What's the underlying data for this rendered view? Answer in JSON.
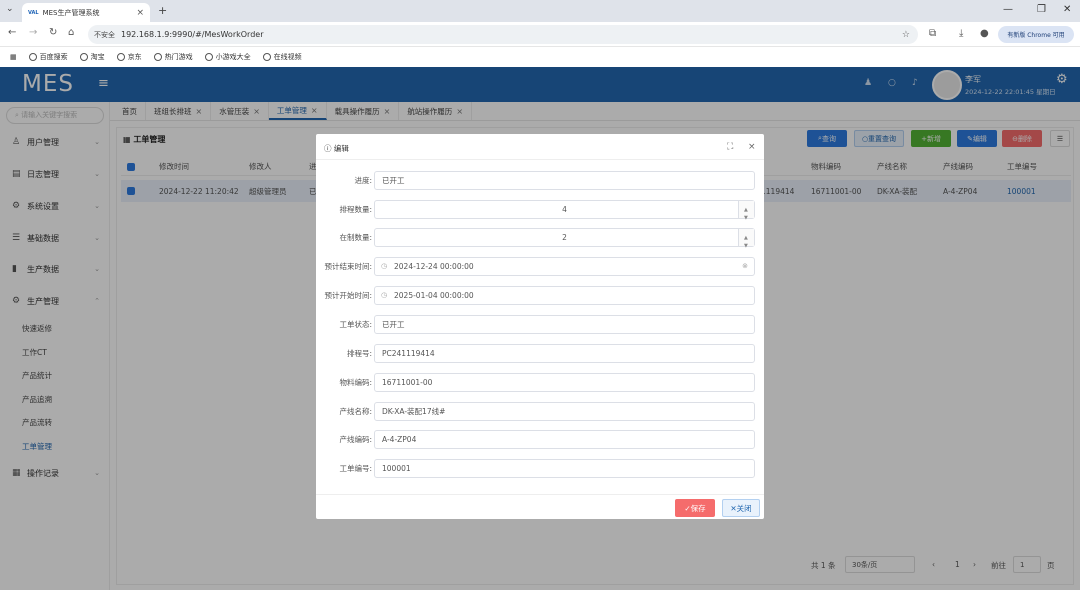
{
  "browser": {
    "tab_title": "MES生产管理系统",
    "tab_favicon": "VAL",
    "security_label": "不安全",
    "url": "192.168.1.9:9990/#/MesWorkOrder",
    "update_label": "有新版 Chrome 可用",
    "bookmarks": [
      "百度搜索",
      "淘宝",
      "京东",
      "热门游戏",
      "小游戏大全",
      "在线视频"
    ]
  },
  "header": {
    "logo": "MES",
    "user_name": "李军",
    "user_time": "2024-12-22 22:01:45 星期日"
  },
  "sidebar": {
    "search_placeholder": "请输入关键字搜索",
    "items": [
      {
        "label": "用户管理",
        "icon": "user-icon"
      },
      {
        "label": "日志管理",
        "icon": "calendar-icon"
      },
      {
        "label": "系统设置",
        "icon": "gear-icon"
      },
      {
        "label": "基础数据",
        "icon": "sliders-icon"
      },
      {
        "label": "生产数据",
        "icon": "bar-chart-icon"
      },
      {
        "label": "生产管理",
        "icon": "gear-icon"
      },
      {
        "label": "操作记录",
        "icon": "grid-icon"
      }
    ],
    "subitems": [
      "快速返修",
      "工作CT",
      "产品统计",
      "产品追溯",
      "产品流转",
      "工单管理"
    ]
  },
  "tabs": [
    {
      "label": "首页",
      "closable": false
    },
    {
      "label": "班组长排班",
      "closable": true
    },
    {
      "label": "水管压装",
      "closable": true
    },
    {
      "label": "工单管理",
      "closable": true
    },
    {
      "label": "载具操作履历",
      "closable": true
    },
    {
      "label": "航站操作履历",
      "closable": true
    }
  ],
  "card": {
    "title": "工单管理",
    "toolbar": {
      "query": "查询",
      "reset": "重置查询",
      "add": "新增",
      "edit": "编辑",
      "delete": "删除"
    },
    "columns": [
      "修改时间",
      "修改人",
      "进",
      "物料编码",
      "产线名称",
      "产线编码",
      "工单编号"
    ],
    "row": {
      "modified_time": "2024-12-22 11:20:42",
      "modifier": "超级管理员",
      "prog": "已",
      "hidden_code": "1119414",
      "material_code": "16711001-00",
      "line_name": "DK-XA-装配",
      "line_code": "A-4-ZP04",
      "order_no": "100001"
    },
    "pager": {
      "total": "共 1 条",
      "page_size": "30条/页",
      "page": "1",
      "goto_label": "前往",
      "goto_value": "1",
      "page_unit": "页"
    }
  },
  "modal": {
    "title": "编辑",
    "fields": {
      "progress": {
        "label": "进度:",
        "value": "已开工"
      },
      "planned_qty": {
        "label": "排程数量:",
        "value": "4"
      },
      "wip_qty": {
        "label": "在制数量:",
        "value": "2"
      },
      "plan_end": {
        "label": "预计结束时间:",
        "value": "2024-12-24 00:00:00"
      },
      "plan_start": {
        "label": "预计开始时间:",
        "value": "2025-01-04 00:00:00"
      },
      "status": {
        "label": "工单状态:",
        "value": "已开工"
      },
      "schedule_no": {
        "label": "排程号:",
        "value": "PC241119414"
      },
      "material_code": {
        "label": "物料编码:",
        "value": "16711001-00"
      },
      "line_name": {
        "label": "产线名称:",
        "value": "DK-XA-装配17线#"
      },
      "line_code": {
        "label": "产线编码:",
        "value": "A-4-ZP04"
      },
      "order_no": {
        "label": "工单编号:",
        "value": "100001"
      }
    },
    "save_label": "保存",
    "close_label": "关闭"
  },
  "colors": {
    "primary": "#2368b0",
    "danger": "#f56c6c",
    "success": "#52b435"
  }
}
